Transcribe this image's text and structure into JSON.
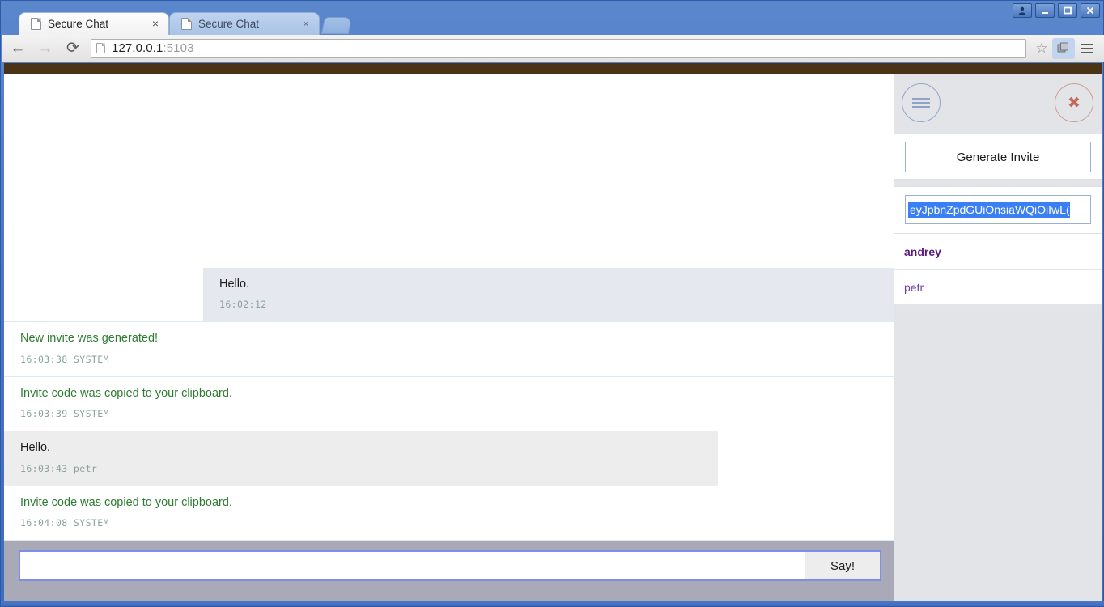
{
  "browser": {
    "tabs": [
      {
        "title": "Secure Chat",
        "favicon": "page-icon",
        "close_label": "×",
        "active": true
      },
      {
        "title": "Secure Chat",
        "favicon": "page-icon",
        "close_label": "×",
        "active": false
      }
    ],
    "new_tab_label": "",
    "window_controls": {
      "user_label": "user-icon",
      "minimize_label": "minimize-icon",
      "maximize_label": "maximize-icon",
      "close_label": "close-icon"
    },
    "nav": {
      "back_label": "←",
      "forward_label": "→",
      "reload_label": "⟳",
      "url_host": "127.0.0.1",
      "url_port": ":5103",
      "star_label": "☆",
      "extension_label": "extension-icon",
      "menu_label": "menu-icon"
    }
  },
  "chat": {
    "messages": [
      {
        "kind": "own",
        "text": "Hello.",
        "time": "16:02:12",
        "author": ""
      },
      {
        "kind": "system",
        "text": "New invite was generated!",
        "time": "16:03:38",
        "author": "SYSTEM"
      },
      {
        "kind": "system",
        "text": "Invite code was copied to your clipboard.",
        "time": "16:03:39",
        "author": "SYSTEM"
      },
      {
        "kind": "other",
        "text": "Hello.",
        "time": "16:03:43",
        "author": "petr"
      },
      {
        "kind": "system",
        "text": "Invite code was copied to your clipboard.",
        "time": "16:04:08",
        "author": "SYSTEM"
      }
    ],
    "composer": {
      "input_value": "",
      "input_placeholder": "",
      "send_label": "Say!"
    }
  },
  "sidebar": {
    "menu_toggle_label": "hamburger-icon",
    "close_label": "✖",
    "generate_invite_label": "Generate Invite",
    "invite_code_value": "eyJpbnZpdGUiOnsiaWQiOiIwL(",
    "invite_code_placeholder": "",
    "users": [
      {
        "name": "andrey",
        "self": true
      },
      {
        "name": "petr",
        "self": false
      }
    ]
  },
  "colors": {
    "topbar": "#4b3317",
    "sidebar_bg": "#e2e4e8",
    "system_text": "#2e7d32",
    "own_bubble": "#e5e8ef",
    "other_bubble": "#ededed",
    "selection": "#3b7ff5",
    "user_self": "#5a1a7a",
    "user_other": "#6b3fa0",
    "page_bg": "#a9a9b8"
  }
}
